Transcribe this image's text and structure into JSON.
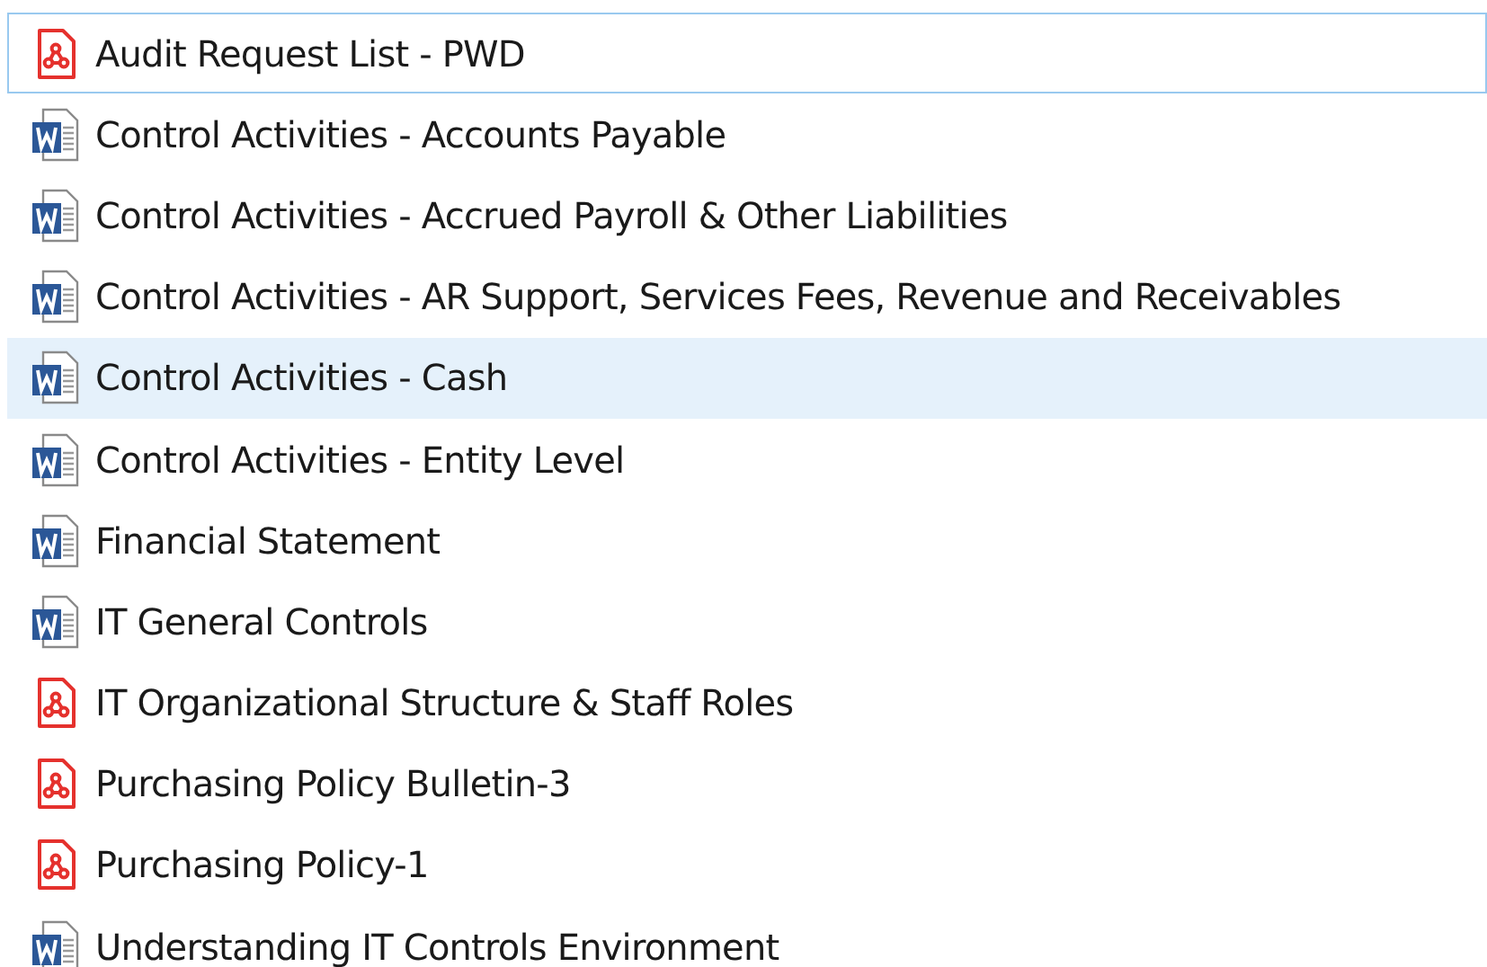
{
  "files": [
    {
      "kind": "pdf",
      "name": "Audit Request List - PWD",
      "selected": false,
      "focused": true
    },
    {
      "kind": "word",
      "name": "Control Activities - Accounts Payable",
      "selected": false,
      "focused": false
    },
    {
      "kind": "word",
      "name": "Control Activities - Accrued Payroll & Other Liabilities",
      "selected": false,
      "focused": false
    },
    {
      "kind": "word",
      "name": "Control Activities - AR Support, Services Fees, Revenue and Receivables",
      "selected": false,
      "focused": false
    },
    {
      "kind": "word",
      "name": "Control Activities - Cash",
      "selected": true,
      "focused": false
    },
    {
      "kind": "word",
      "name": "Control Activities - Entity Level",
      "selected": false,
      "focused": false
    },
    {
      "kind": "word",
      "name": "Financial Statement",
      "selected": false,
      "focused": false
    },
    {
      "kind": "word",
      "name": "IT General Controls",
      "selected": false,
      "focused": false
    },
    {
      "kind": "pdf",
      "name": "IT Organizational Structure & Staff Roles",
      "selected": false,
      "focused": false
    },
    {
      "kind": "pdf",
      "name": "Purchasing Policy Bulletin-3",
      "selected": false,
      "focused": false
    },
    {
      "kind": "pdf",
      "name": "Purchasing Policy-1",
      "selected": false,
      "focused": false
    },
    {
      "kind": "word",
      "name": "Understanding IT Controls Environment",
      "selected": false,
      "focused": false
    }
  ]
}
